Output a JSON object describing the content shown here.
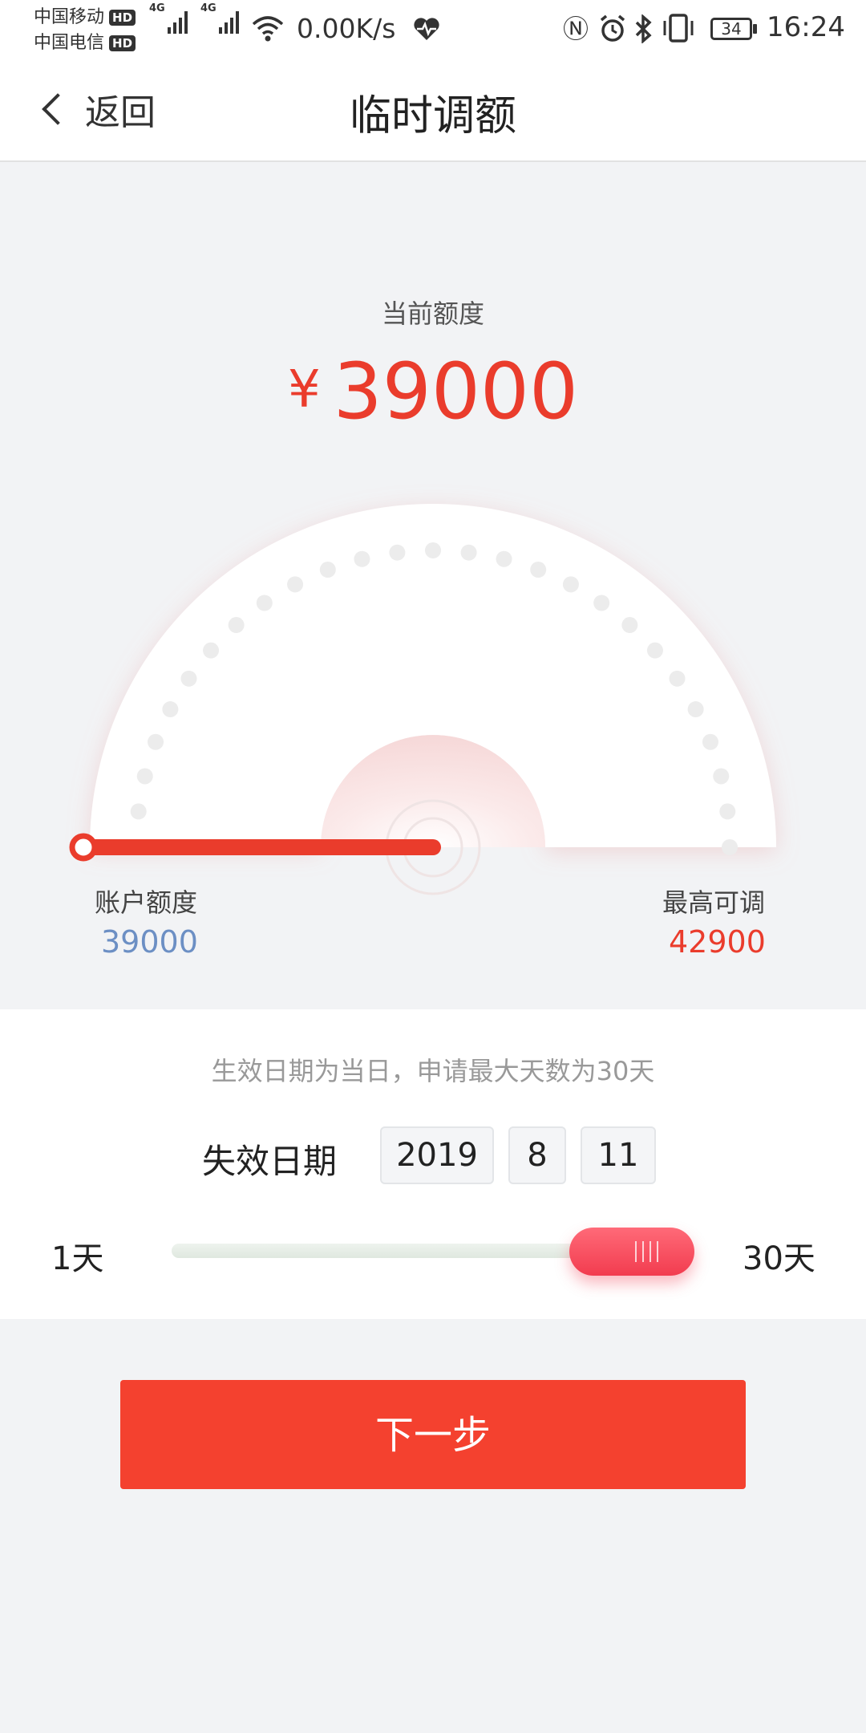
{
  "status_bar": {
    "carrier1": "中国移动",
    "carrier2": "中国电信",
    "hd": "HD",
    "network": "4G",
    "speed": "0.00K/s",
    "battery": "34",
    "time": "16:24"
  },
  "nav": {
    "back_label": "返回",
    "title": "临时调额"
  },
  "quota": {
    "label": "当前额度",
    "currency": "¥",
    "amount": "39000"
  },
  "gauge": {
    "left_label": "账户额度",
    "left_value": "39000",
    "right_label": "最高可调",
    "right_value": "42900",
    "level": 0
  },
  "date_section": {
    "note": "生效日期为当日，申请最大天数为30天",
    "expiry_label": "失效日期",
    "year": "2019",
    "month": "8",
    "day": "11"
  },
  "slider": {
    "min_label": "1天",
    "max_label": "30天",
    "min": 1,
    "max": 30,
    "value": 30
  },
  "next_button": {
    "label": "下一步"
  },
  "colors": {
    "accent": "#f4412f",
    "amount_red": "#ea3c2c",
    "account_blue": "#6c8fc4",
    "slider_thumb": "#f23c4f"
  }
}
